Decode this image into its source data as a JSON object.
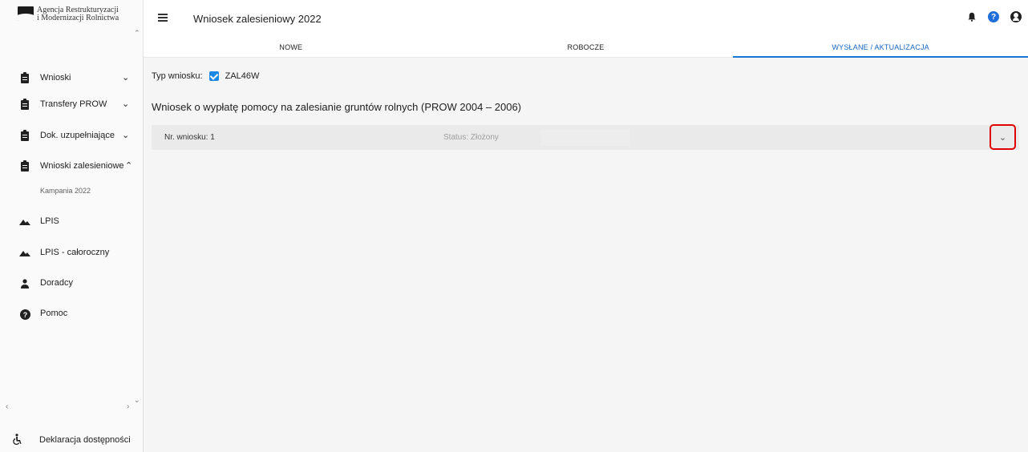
{
  "brand": {
    "line1": "Agencja Restrukturyzacji",
    "line2": "i Modernizacji Rolnictwa"
  },
  "header": {
    "title": "Wniosek zalesieniowy 2022"
  },
  "tabs": [
    {
      "label": "NOWE"
    },
    {
      "label": "ROBOCZE"
    },
    {
      "label": "WYSŁANE / AKTUALIZACJA"
    }
  ],
  "sidebar": {
    "items": [
      {
        "label": "Wnioski",
        "icon": "clipboard-icon"
      },
      {
        "label": "Transfery PROW",
        "icon": "clipboard-icon"
      },
      {
        "label": "Dok. uzupełniające",
        "icon": "clipboard-icon"
      },
      {
        "label": "Wnioski zalesieniowe",
        "icon": "clipboard-icon"
      },
      {
        "label": "LPIS",
        "icon": "terrain-icon"
      },
      {
        "label": "LPIS - całoroczny",
        "icon": "terrain-icon"
      },
      {
        "label": "Doradcy",
        "icon": "person-icon"
      },
      {
        "label": "Pomoc",
        "icon": "help-icon"
      }
    ],
    "sub_item": "Kampania 2022",
    "footer": "Deklaracja dostępności"
  },
  "main": {
    "type_label": "Typ wniosku:",
    "type_value": "ZAL46W",
    "section_title": "Wniosek o wypłatę pomocy na zalesianie gruntów rolnych (PROW 2004 – 2006)",
    "row": {
      "number": "Nr. wniosku: 1",
      "status": "Status: Złożony"
    }
  },
  "colors": {
    "accent": "#1976d2",
    "highlight": "#e00000"
  }
}
